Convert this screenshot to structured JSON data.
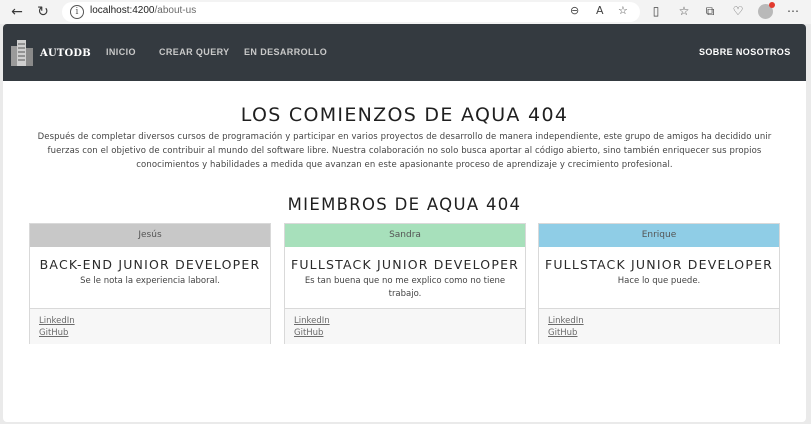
{
  "browser": {
    "url_host": "localhost:4200",
    "url_path": "/about-us"
  },
  "navbar": {
    "brand": "AUTODB",
    "links": [
      "INICIO",
      "CREAR QUERY",
      "EN DESARROLLO"
    ],
    "right_link": "SOBRE NOSOTROS"
  },
  "hero": {
    "title": "LOS COMIENZOS DE AQUA 404",
    "text": "Después de completar diversos cursos de programación y participar en varios proyectos de desarrollo de manera independiente, este grupo de amigos ha decidido unir fuerzas con el objetivo de contribuir al mundo del software libre. Nuestra colaboración no solo busca aportar al código abierto, sino también enriquecer sus propios conocimientos y habilidades a medida que avanzan en este apasionante proceso de aprendizaje y crecimiento profesional."
  },
  "members": {
    "title": "MIEMBROS DE AQUA 404",
    "cards": [
      {
        "name": "Jesús",
        "role": "BACK-END JUNIOR DEVELOPER",
        "description": "Se le nota la experiencia laboral.",
        "header_color": "#c8c8c8",
        "link1": "LinkedIn",
        "link2": "GitHub"
      },
      {
        "name": "Sandra",
        "role": "FULLSTACK JUNIOR DEVELOPER",
        "description": "Es tan buena que no me explico como no tiene trabajo.",
        "header_color": "#a7e0bb",
        "link1": "LinkedIn",
        "link2": "GitHub"
      },
      {
        "name": "Enrique",
        "role": "FULLSTACK JUNIOR DEVELOPER",
        "description": "Hace lo que puede.",
        "header_color": "#8fcde6",
        "link1": "LinkedIn",
        "link2": "GitHub"
      }
    ]
  },
  "colors": {
    "navbar_bg": "#343a40"
  }
}
